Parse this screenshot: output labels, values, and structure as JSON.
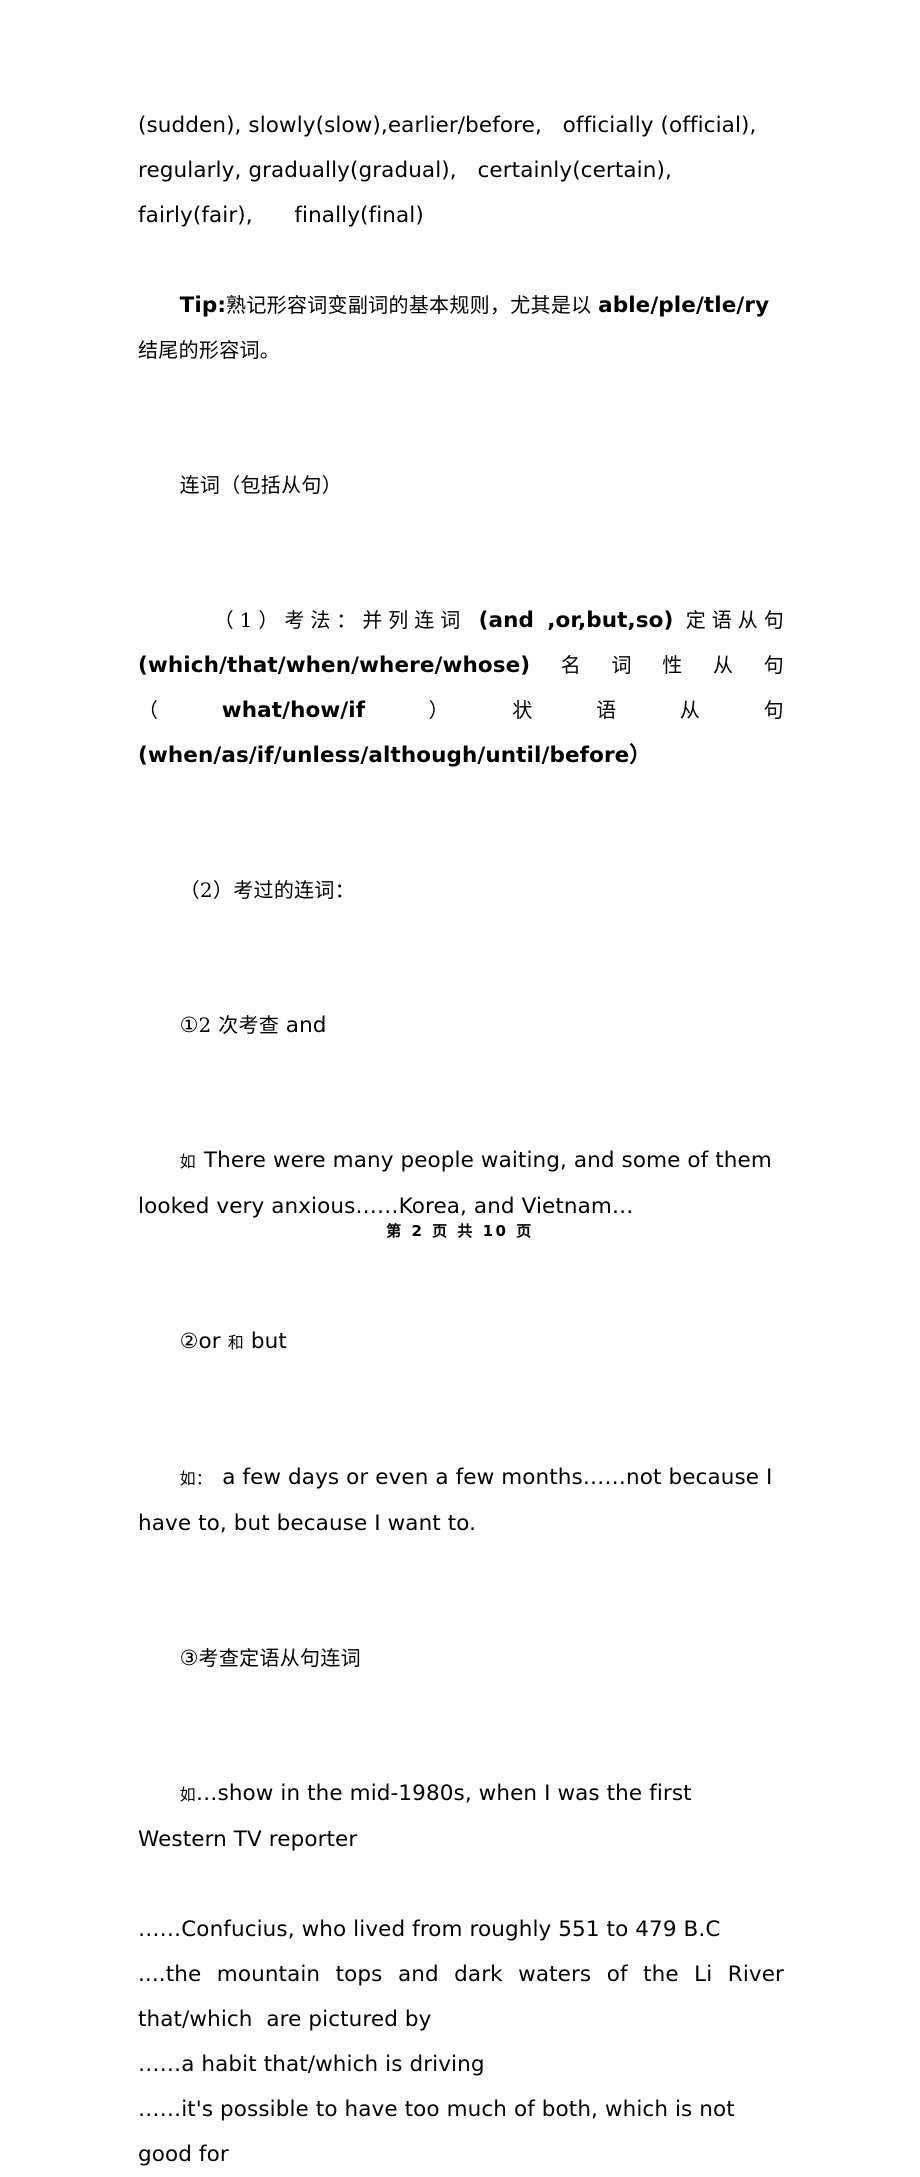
{
  "document": {
    "page_label": "第 2 页 共 10 页",
    "text_color": "#000000",
    "background_color": "#ffffff"
  },
  "body": {
    "adverb_list": {
      "line1": "(sudden), slowly(slow),earlier/before,   officially (official),",
      "line2": "regularly, gradually(gradual),   certainly(certain),",
      "line3": "fairly(fair),      finally(final)"
    },
    "tip": {
      "label": "Tip:",
      "cn_part1": "熟记形容词变副词的基本规则，尤其是以 ",
      "en_part": "able/ple/tle/ry",
      "cn_part2": " 结尾的形容词。"
    },
    "section_heading": "连词（包括从句）",
    "item1": {
      "marker": "（1）考法：",
      "text_a": "并列连词 ",
      "text_b": "(and ,or,but,so)",
      "text_c": " 定语从句",
      "text_d": "(which/that/when/where/whose)",
      "text_e": "名词性从句（",
      "text_f": "what/how/if",
      "text_g": "）状语从句 ",
      "text_h": "(when/as/if/unless/although/until/before）"
    },
    "item2": {
      "marker": "（2）考过的连词："
    },
    "sub1": {
      "marker": "①",
      "cn": "2 次考查 ",
      "en": "and"
    },
    "example1": {
      "marker": "如",
      "text": "There were many people waiting, and some of them looked very anxious……Korea, and Vietnam…"
    },
    "sub2": {
      "marker": "②",
      "en1": "or ",
      "cn": "和",
      "en2": " but"
    },
    "example2": {
      "marker": "如：",
      "text": "a few days or even a few months……not because I have to, but because I want to."
    },
    "sub3": {
      "marker": "③",
      "cn": "考查定语从句连词"
    },
    "example3": {
      "marker": "如",
      "line1": "…show in the mid-1980s, when I was the first Western TV reporter",
      "line2": "……Confucius, who lived from roughly 551 to 479 B.C",
      "line3": "....the mountain tops and dark waters of the Li River that/which  are pictured by",
      "line4": "……a habit that/which is driving",
      "line5": "……it's possible to have too much of both, which is not good for"
    }
  }
}
